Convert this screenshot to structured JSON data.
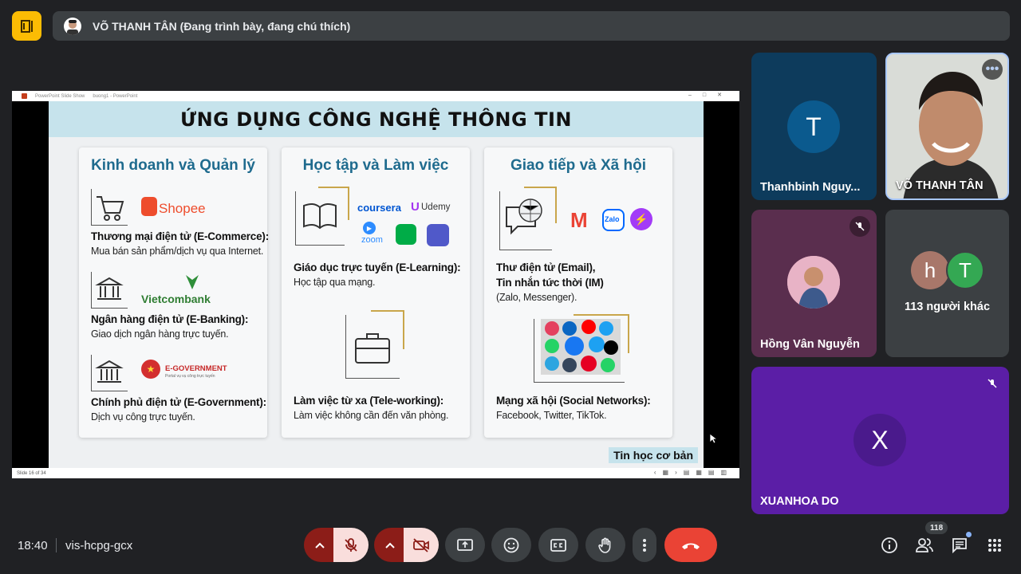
{
  "topbar": {
    "presenter": "VÕ THANH TÂN (Đang trình bày, đang chú thích)"
  },
  "powerpoint": {
    "window_title": "PowerPoint Slide Show",
    "file_title": "buong1 - PowerPoint",
    "slide_counter": "Slide 16 of 34"
  },
  "slide": {
    "title": "ỨNG DỤNG CÔNG NGHỆ THÔNG TIN",
    "footer_tag": "Tin học cơ bản",
    "columns": [
      {
        "heading": "Kinh doanh và Quản lý",
        "items": [
          {
            "title": "Thương mại điện tử (E-Commerce):",
            "desc": "Mua bán sản phẩm/dịch vụ qua Internet.",
            "logo": "Shopee"
          },
          {
            "title": "Ngân hàng điện tử (E-Banking):",
            "desc": "Giao dịch ngân hàng trực tuyến.",
            "logo": "Vietcombank"
          },
          {
            "title": "Chính phủ điện tử (E-Government):",
            "desc": "Dịch vụ công trực tuyến.",
            "logo": "E-GOVERNMENT",
            "logo_sub": "Portal vụ vụ công trực tuyến"
          }
        ]
      },
      {
        "heading": "Học tập và Làm việc",
        "items": [
          {
            "title": "Giáo dục trực tuyến (E-Learning):",
            "desc": "Học tập qua mạng."
          },
          {
            "title": "Làm việc từ xa (Tele-working):",
            "desc": "Làm việc không cần đến văn phòng."
          }
        ],
        "logos": {
          "coursera": "coursera",
          "udemy": "Udemy",
          "zoom": "zoom"
        }
      },
      {
        "heading": "Giao tiếp và Xã hội",
        "items": [
          {
            "title": "Thư điện tử (Email),",
            "title2": "Tin nhắn tức thời (IM)",
            "desc": "(Zalo, Messenger)."
          },
          {
            "title": "Mạng xã hội (Social Networks):",
            "desc": "Facebook, Twitter, TikTok."
          }
        ],
        "logos": {
          "zalo": "Zalo"
        }
      }
    ]
  },
  "participants": [
    {
      "name": "Thanhbinh Nguy...",
      "initial": "T",
      "bg": "#0d3b5c",
      "circle": "#0b5a8e"
    },
    {
      "name": "VÕ THANH TÂN",
      "bg": "#cfd4cf"
    },
    {
      "name": "Hồng Vân Nguyễn",
      "bg": "#5a2e4e"
    },
    {
      "name": "113 người khác",
      "initials": [
        "h",
        "T"
      ],
      "bg": "#3c4043"
    },
    {
      "name": "XUANHOA DO",
      "initial": "X",
      "bg": "#5b1ea6",
      "circle": "#4a1a8c"
    }
  ],
  "bottombar": {
    "time": "18:40",
    "meeting_code": "vis-hcpg-gcx",
    "participant_count": "118",
    "colors": {
      "danger": "#ea4335",
      "muted_bg": "#f9dedc",
      "muted_dark": "#8c1d18"
    }
  }
}
